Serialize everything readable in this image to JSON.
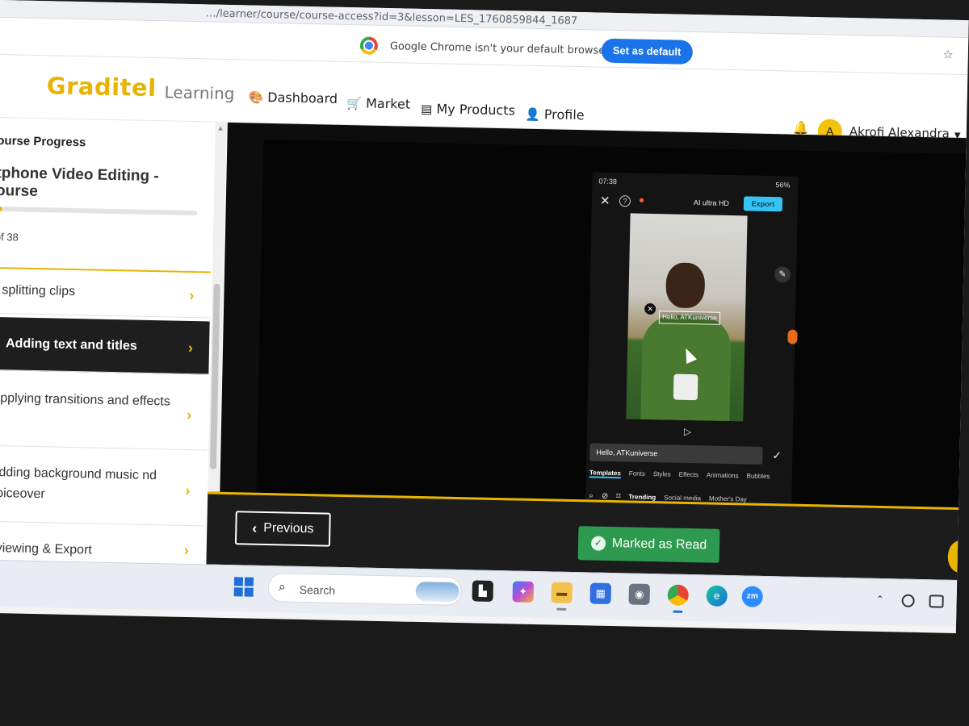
{
  "browser": {
    "url": "…/learner/course/course-access?id=3&lesson=LES_1760859844_1687",
    "infobar_message": "Google Chrome isn't your default browser",
    "infobar_button": "Set as default",
    "star_icon": "star-icon"
  },
  "header": {
    "logo": "Graditel",
    "logo_sub": "Learning",
    "nav": [
      {
        "label": "Dashboard",
        "icon": "palette-icon"
      },
      {
        "label": "Market",
        "icon": "cart-icon"
      },
      {
        "label": "My Products",
        "icon": "book-icon"
      },
      {
        "label": "Profile",
        "icon": "user-icon"
      }
    ],
    "user_initial": "A",
    "user_name": "Akrofi Alexandra"
  },
  "sidebar": {
    "progress_heading": "ourse Progress",
    "course_title": "tphone Video Editing - ourse",
    "progress_fraction": 0.03,
    "progress_count": "of 38",
    "lessons": [
      {
        "label": "splitting clips",
        "active": false
      },
      {
        "label": "Adding text and titles",
        "active": true
      },
      {
        "label": "Applying transitions and effects",
        "active": false
      },
      {
        "label": "Adding background music nd voiceover",
        "active": false
      },
      {
        "label": "eviewing & Export",
        "active": false
      }
    ]
  },
  "phone": {
    "time": "07:38",
    "battery": "56%",
    "ai_label": "AI ultra HD",
    "export_label": "Export",
    "overlay_text": "Hello, ATKuniverse",
    "text_input": "Hello, ATKuniverse",
    "tabs": [
      "Templates",
      "Fonts",
      "Styles",
      "Effects",
      "Animations",
      "Bubbles"
    ],
    "active_tab": "Templates",
    "filters": [
      "Trending",
      "Social media",
      "Mother's Day"
    ],
    "active_filter": "Trending"
  },
  "footer": {
    "previous_label": "Previous",
    "marked_label": "Marked as Read"
  },
  "taskbar": {
    "search_label": "Search"
  },
  "colors": {
    "brand_yellow": "#e8b400",
    "success_green": "#2e9a4f",
    "chrome_blue": "#1a73e8",
    "dark_panel": "#1c1c1c"
  }
}
